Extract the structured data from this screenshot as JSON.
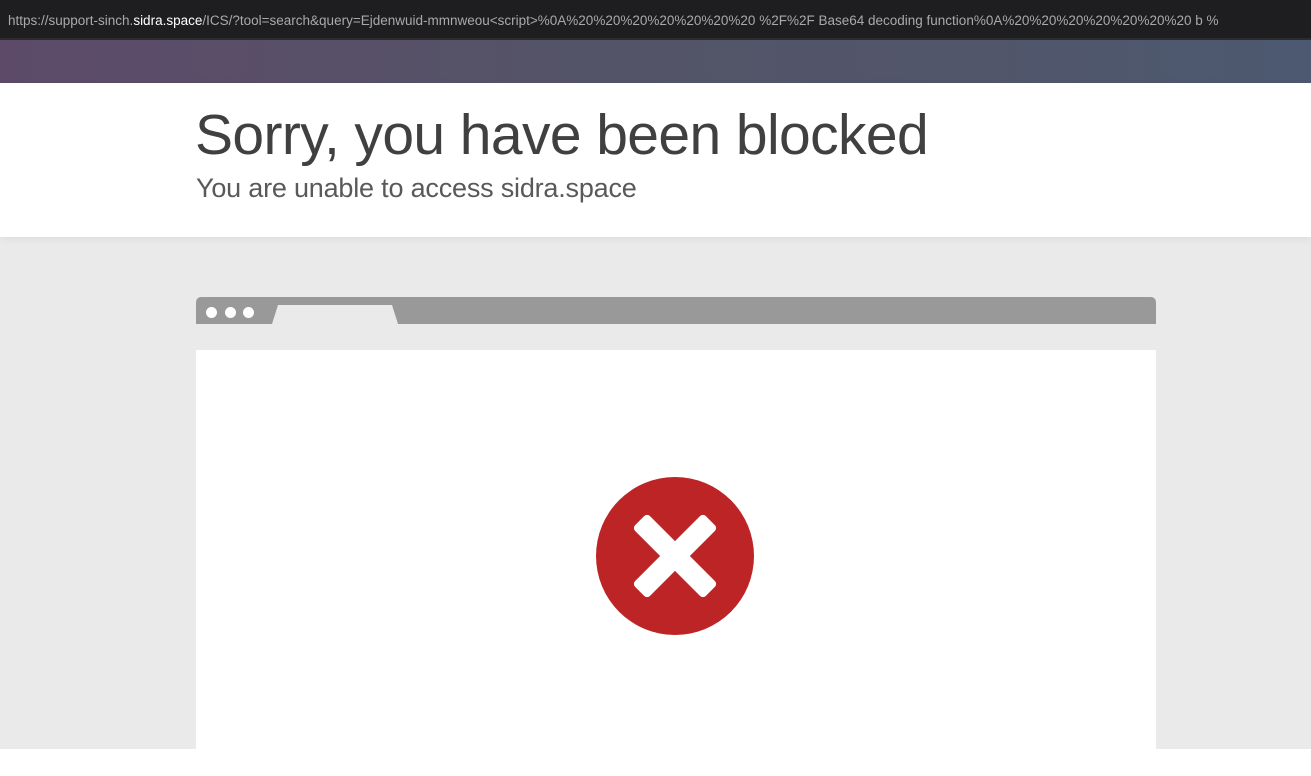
{
  "address_bar": {
    "url_prefix": "https://support-sinch.",
    "url_host": "sidra.space",
    "url_suffix": "/ICS/?tool=search&query=Ejdenwuid-mmnweou<script>%0A%20%20%20%20%20%20%20 %2F%2F Base64 decoding function%0A%20%20%20%20%20%20%20 b %"
  },
  "header": {
    "title": "Sorry, you have been blocked",
    "subtitle": "You are unable to access sidra.space"
  },
  "illustration": {
    "error_icon": "close-circle-icon",
    "error_color": "#bd2426",
    "frame_color": "#999999",
    "background_color": "#eaeaea"
  }
}
